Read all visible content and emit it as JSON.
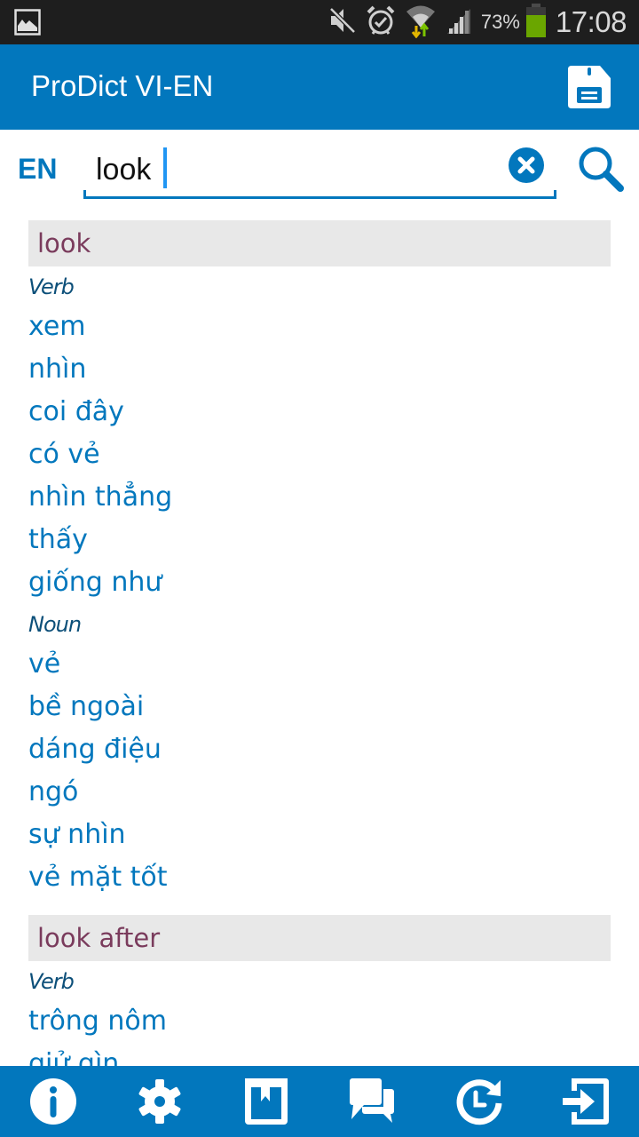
{
  "status_bar": {
    "left_icons": [
      "gallery-icon"
    ],
    "right_icons": [
      "mute-icon",
      "alarm-icon",
      "wifi-icon",
      "signal-icon",
      "battery-icon"
    ],
    "battery_percent": "73%",
    "battery_level": 0.73,
    "time": "17:08"
  },
  "app_bar": {
    "title": "ProDict VI-EN",
    "action_icon": "save-icon"
  },
  "search": {
    "language": "EN",
    "value": "look",
    "clear_icon": "clear-icon",
    "search_icon": "search-icon"
  },
  "results": [
    {
      "headword": "look",
      "groups": [
        {
          "pos": "Verb",
          "meanings": [
            "xem",
            "nhìn",
            "coi đây",
            "có vẻ",
            "nhìn thẳng",
            "thấy",
            "giống như"
          ]
        },
        {
          "pos": "Noun",
          "meanings": [
            "vẻ",
            "bề ngoài",
            "dáng điệu",
            "ngó",
            "sự nhìn",
            "vẻ mặt tốt"
          ]
        }
      ]
    },
    {
      "headword": "look after",
      "groups": [
        {
          "pos": "Verb",
          "meanings": [
            "trông nôm",
            "giử gìn"
          ]
        }
      ]
    }
  ],
  "bottom_bar": [
    {
      "name": "info-button",
      "icon": "info-icon"
    },
    {
      "name": "settings-button",
      "icon": "gear-icon"
    },
    {
      "name": "bookmarks-button",
      "icon": "bookmark-book-icon"
    },
    {
      "name": "feedback-button",
      "icon": "chat-icon"
    },
    {
      "name": "history-button",
      "icon": "history-icon"
    },
    {
      "name": "exit-button",
      "icon": "exit-icon"
    }
  ],
  "colors": {
    "primary": "#0277bd",
    "headword_bg": "#e8e8e8",
    "headword_text": "#7a3b5c",
    "pos_text": "#0c4f79",
    "status_bar": "#1e1e1e"
  }
}
